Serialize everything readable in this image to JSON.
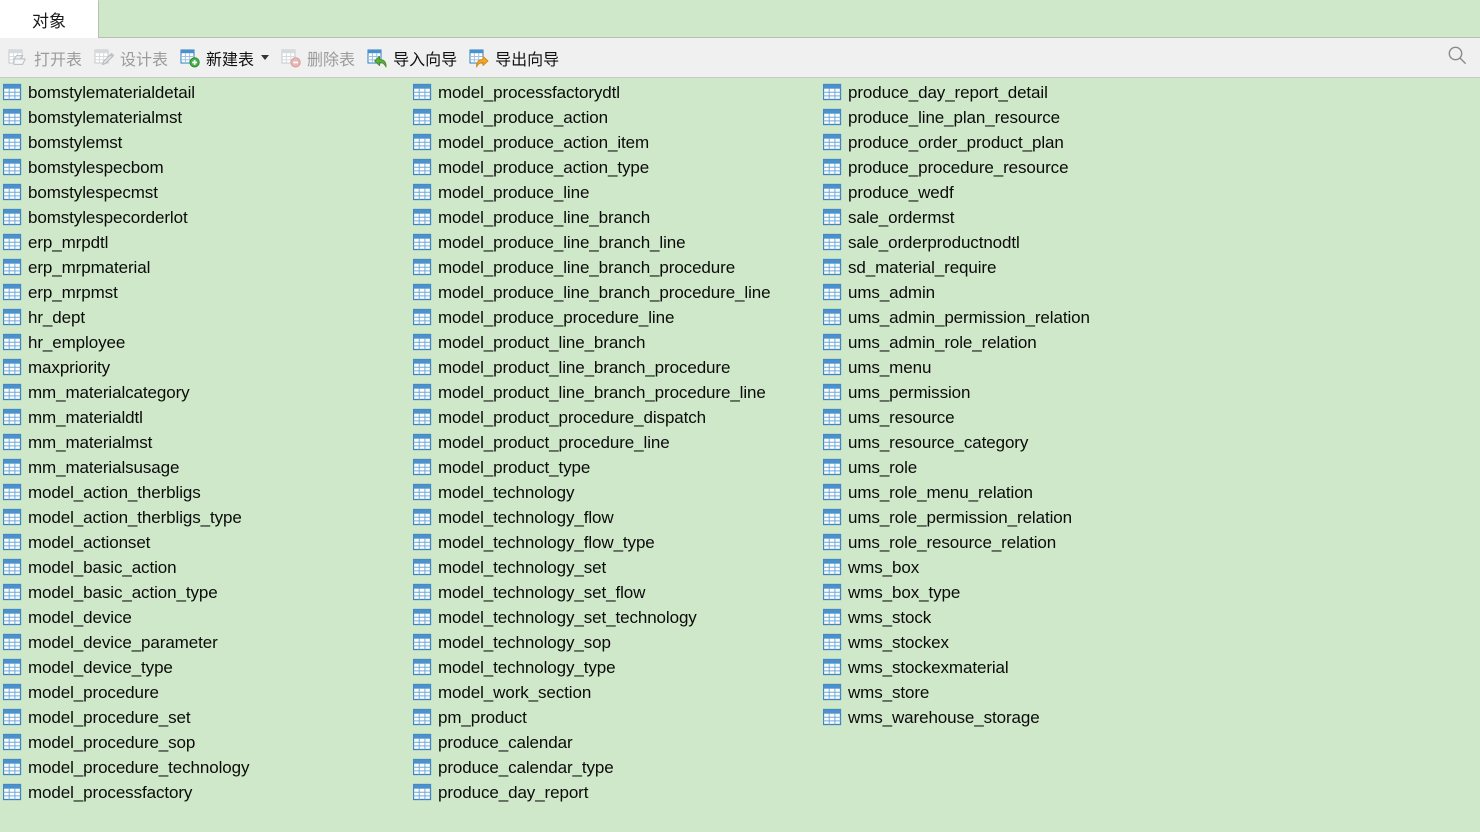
{
  "window": {
    "background_color": "#cfe8c9",
    "toolbar_background": "#f0f0f0"
  },
  "tabs": [
    {
      "label": "对象",
      "active": true
    }
  ],
  "toolbar": {
    "buttons": [
      {
        "label": "打开表",
        "icon": "open-table-icon",
        "enabled": false,
        "dropdown": false
      },
      {
        "label": "设计表",
        "icon": "design-table-icon",
        "enabled": false,
        "dropdown": false
      },
      {
        "label": "新建表",
        "icon": "new-table-icon",
        "enabled": true,
        "dropdown": true
      },
      {
        "label": "删除表",
        "icon": "delete-table-icon",
        "enabled": false,
        "dropdown": false
      },
      {
        "label": "导入向导",
        "icon": "import-wizard-icon",
        "enabled": true,
        "dropdown": false
      },
      {
        "label": "导出向导",
        "icon": "export-wizard-icon",
        "enabled": true,
        "dropdown": false
      }
    ],
    "search_icon": "search-icon"
  },
  "object_list": {
    "icon": "table-icon",
    "columns": [
      {
        "items": [
          "bomstylematerialdetail",
          "bomstylematerialmst",
          "bomstylemst",
          "bomstylespecbom",
          "bomstylespecmst",
          "bomstylespecorderlot",
          "erp_mrpdtl",
          "erp_mrpmaterial",
          "erp_mrpmst",
          "hr_dept",
          "hr_employee",
          "maxpriority",
          "mm_materialcategory",
          "mm_materialdtl",
          "mm_materialmst",
          "mm_materialsusage",
          "model_action_therbligs",
          "model_action_therbligs_type",
          "model_actionset",
          "model_basic_action",
          "model_basic_action_type",
          "model_device",
          "model_device_parameter",
          "model_device_type",
          "model_procedure",
          "model_procedure_set",
          "model_procedure_sop",
          "model_procedure_technology",
          "model_processfactory"
        ]
      },
      {
        "items": [
          "model_processfactorydtl",
          "model_produce_action",
          "model_produce_action_item",
          "model_produce_action_type",
          "model_produce_line",
          "model_produce_line_branch",
          "model_produce_line_branch_line",
          "model_produce_line_branch_procedure",
          "model_produce_line_branch_procedure_line",
          "model_produce_procedure_line",
          "model_product_line_branch",
          "model_product_line_branch_procedure",
          "model_product_line_branch_procedure_line",
          "model_product_procedure_dispatch",
          "model_product_procedure_line",
          "model_product_type",
          "model_technology",
          "model_technology_flow",
          "model_technology_flow_type",
          "model_technology_set",
          "model_technology_set_flow",
          "model_technology_set_technology",
          "model_technology_sop",
          "model_technology_type",
          "model_work_section",
          "pm_product",
          "produce_calendar",
          "produce_calendar_type",
          "produce_day_report"
        ]
      },
      {
        "items": [
          "produce_day_report_detail",
          "produce_line_plan_resource",
          "produce_order_product_plan",
          "produce_procedure_resource",
          "produce_wedf",
          "sale_ordermst",
          "sale_orderproductnodtl",
          "sd_material_require",
          "ums_admin",
          "ums_admin_permission_relation",
          "ums_admin_role_relation",
          "ums_menu",
          "ums_permission",
          "ums_resource",
          "ums_resource_category",
          "ums_role",
          "ums_role_menu_relation",
          "ums_role_permission_relation",
          "ums_role_resource_relation",
          "wms_box",
          "wms_box_type",
          "wms_stock",
          "wms_stockex",
          "wms_stockexmaterial",
          "wms_store",
          "wms_warehouse_storage"
        ]
      }
    ]
  }
}
